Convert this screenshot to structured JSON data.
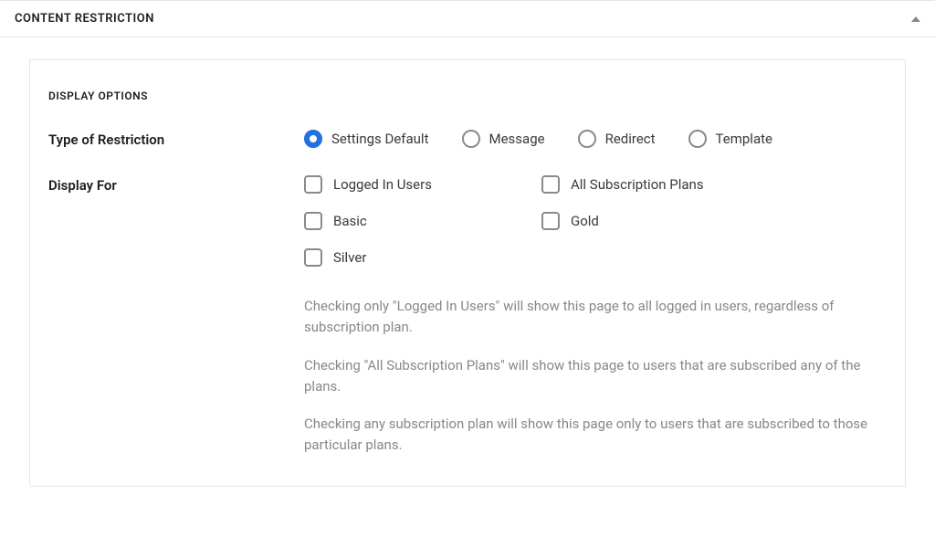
{
  "panel": {
    "title": "CONTENT RESTRICTION"
  },
  "section": {
    "heading": "DISPLAY OPTIONS"
  },
  "restriction": {
    "label": "Type of Restriction",
    "options": [
      {
        "label": "Settings Default",
        "selected": true
      },
      {
        "label": "Message",
        "selected": false
      },
      {
        "label": "Redirect",
        "selected": false
      },
      {
        "label": "Template",
        "selected": false
      }
    ]
  },
  "display_for": {
    "label": "Display For",
    "options": [
      {
        "label": "Logged In Users",
        "checked": false
      },
      {
        "label": "All Subscription Plans",
        "checked": false
      },
      {
        "label": "Basic",
        "checked": false
      },
      {
        "label": "Gold",
        "checked": false
      },
      {
        "label": "Silver",
        "checked": false
      }
    ],
    "help": [
      "Checking only \"Logged In Users\" will show this page to all logged in users, regardless of subscription plan.",
      "Checking \"All Subscription Plans\" will show this page to users that are subscribed any of the plans.",
      "Checking any subscription plan will show this page only to users that are subscribed to those particular plans."
    ]
  }
}
